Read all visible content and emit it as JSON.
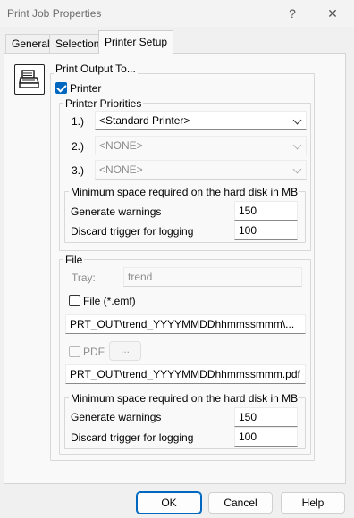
{
  "window": {
    "title": "Print Job Properties",
    "help_glyph": "?",
    "close_glyph": "✕"
  },
  "tabs": [
    {
      "label": "General"
    },
    {
      "label": "Selection"
    },
    {
      "label": "Printer Setup"
    }
  ],
  "printer_output": {
    "legend": "Print Output To...",
    "printer_checkbox_label": "Printer",
    "printer_checked": true
  },
  "printer_priorities": {
    "legend": "Printer Priorities",
    "rows": [
      {
        "index": "1.)",
        "value": "<Standard Printer>",
        "enabled": true
      },
      {
        "index": "2.)",
        "value": "<NONE>",
        "enabled": false
      },
      {
        "index": "3.)",
        "value": "<NONE>",
        "enabled": false
      }
    ],
    "min_space": {
      "legend": "Minimum space required on the hard disk in MB",
      "warnings_label": "Generate warnings",
      "warnings_value": "150",
      "discard_label": "Discard trigger for logging",
      "discard_value": "100"
    }
  },
  "file": {
    "legend": "File",
    "tray_label": "Tray:",
    "tray_value": "trend",
    "file_checkbox_label": "File  (*.emf)",
    "file_checked": false,
    "file_path": "PRT_OUT\\trend_YYYYMMDDhhmmssmmm\\...",
    "pdf_checkbox_label": "PDF",
    "pdf_checked": false,
    "browse_label": "...",
    "pdf_path": "PRT_OUT\\trend_YYYYMMDDhhmmssmmm.pdf",
    "min_space": {
      "legend": "Minimum space required on the hard disk in MB",
      "warnings_label": "Generate warnings",
      "warnings_value": "150",
      "discard_label": "Discard trigger for logging",
      "discard_value": "100"
    }
  },
  "buttons": {
    "ok": "OK",
    "cancel": "Cancel",
    "help": "Help"
  },
  "colors": {
    "accent": "#0067c0",
    "disabled_text": "#8d8d8d"
  }
}
